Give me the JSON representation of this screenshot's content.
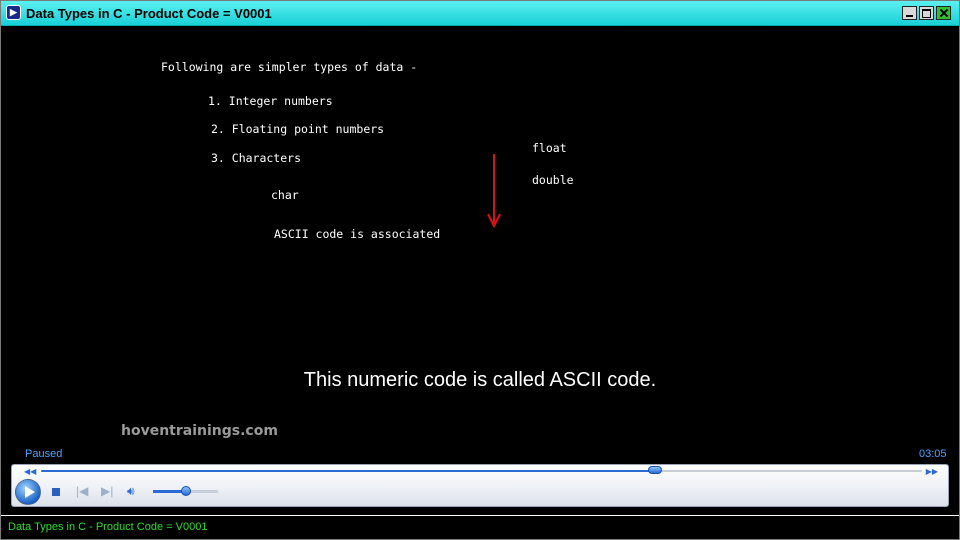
{
  "window": {
    "title": "Data Types in C - Product Code = V0001",
    "title_icon": "media-player-icon"
  },
  "slide": {
    "heading": "Following are simpler types of data -",
    "items": [
      "1. Integer numbers",
      "2. Floating point numbers",
      "3. Characters"
    ],
    "float_label": "float",
    "double_label": "double",
    "char_label": "char",
    "ascii_note": "ASCII code is associated",
    "arrow_color": "#e01010"
  },
  "subtitle": "This numeric code is called ASCII code.",
  "watermark": "hoventrainings.com",
  "player": {
    "status": "Paused",
    "time": "03:05",
    "seek_fraction": 0.697,
    "volume_fraction": 0.5,
    "accent_color": "#2a6bd6"
  },
  "statusbar": {
    "text": "Data Types in C - Product Code = V0001"
  }
}
